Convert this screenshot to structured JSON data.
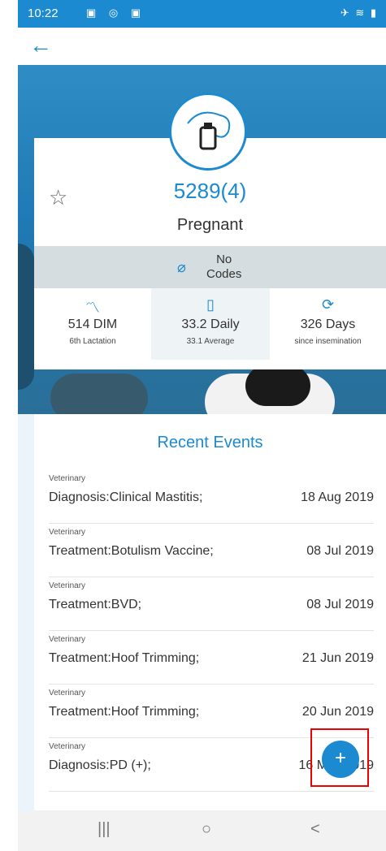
{
  "status_bar": {
    "time": "10:22",
    "left_icons": "▣ ◎ ▣",
    "right_icons": "✈ ≋ ▮"
  },
  "header": {
    "back_icon": "arrow-left"
  },
  "animal": {
    "id": "5289(4)",
    "status": "Pregnant",
    "codes_label": "No\nCodes"
  },
  "stats": [
    {
      "value": "514 DIM",
      "label": "6th Lactation",
      "icon": "lactation-curve-icon"
    },
    {
      "value": "33.2 Daily",
      "label": "33.1 Average",
      "icon": "milk-icon"
    },
    {
      "value": "326 Days",
      "label": "since insemination",
      "icon": "insemination-icon"
    }
  ],
  "events": {
    "title": "Recent Events",
    "items": [
      {
        "category": "Veterinary",
        "description": "Diagnosis:Clinical Mastitis;",
        "date": "18 Aug 2019"
      },
      {
        "category": "Veterinary",
        "description": "Treatment:Botulism Vaccine;",
        "date": "08 Jul 2019"
      },
      {
        "category": "Veterinary",
        "description": "Treatment:BVD;",
        "date": "08 Jul 2019"
      },
      {
        "category": "Veterinary",
        "description": "Treatment:Hoof Trimming;",
        "date": "21 Jun 2019"
      },
      {
        "category": "Veterinary",
        "description": "Treatment:Hoof Trimming;",
        "date": "20 Jun 2019"
      },
      {
        "category": "Veterinary",
        "description": "Diagnosis:PD (+);",
        "date": "16 May 2019"
      }
    ]
  },
  "fab": {
    "label": "+"
  },
  "nav": {
    "recent": "|||",
    "home": "○",
    "back": "<"
  },
  "colors": {
    "primary": "#1b8ad1",
    "highlight": "#e00000"
  }
}
